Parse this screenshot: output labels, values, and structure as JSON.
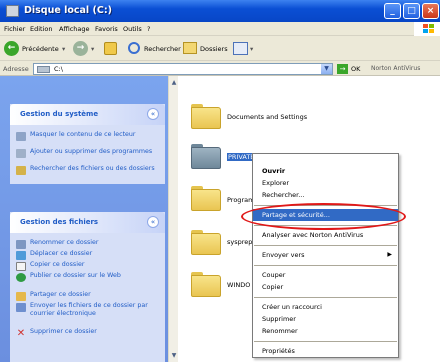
{
  "window": {
    "title": "Disque local (C:)"
  },
  "menubar": {
    "items": [
      "Fichier",
      "Edition",
      "Affichage",
      "Favoris",
      "Outils",
      "?"
    ]
  },
  "toolbar": {
    "back_label": "Précédente",
    "search_label": "Rechercher",
    "folders_label": "Dossiers"
  },
  "address": {
    "label": "Adresse",
    "value": "C:\\",
    "go_label": "OK",
    "addon_label": "Norton AntiVirus"
  },
  "system_tasks": {
    "title": "Gestion du système",
    "items": [
      "Masquer le contenu de ce lecteur",
      "Ajouter ou supprimer des programmes",
      "Rechercher des fichiers ou des dossiers"
    ]
  },
  "file_tasks": {
    "title": "Gestion des fichiers",
    "items": [
      "Renommer ce dossier",
      "Déplacer ce dossier",
      "Copier ce dossier",
      "Publier ce dossier sur le Web",
      "Partager ce dossier",
      "Envoyer les fichiers de ce dossier par courrier électronique",
      "Supprimer ce dossier"
    ]
  },
  "folders": [
    "Documents and Settings",
    "PRIVATE",
    "Program",
    "sysprep",
    "WINDO"
  ],
  "context_menu": {
    "items": [
      "Ouvrir",
      "Explorer",
      "Rechercher...",
      "Partage et sécurité...",
      "Analyser avec Norton AntiVirus",
      "Envoyer vers",
      "Couper",
      "Copier",
      "Créer un raccourci",
      "Supprimer",
      "Renommer",
      "Propriétés"
    ]
  },
  "colors": {
    "highlight": "#316ac5",
    "annotation": "#e01818",
    "folder": "#f3d772"
  }
}
